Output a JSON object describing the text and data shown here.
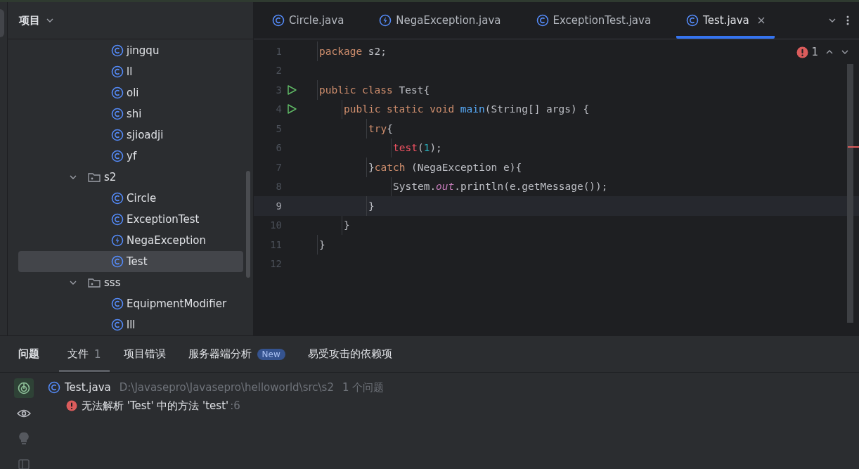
{
  "project_panel": {
    "title": "项目",
    "tree": [
      {
        "kind": "class",
        "label": "jingqu",
        "selected": false
      },
      {
        "kind": "class",
        "label": "ll",
        "selected": false
      },
      {
        "kind": "class",
        "label": "oli",
        "selected": false
      },
      {
        "kind": "class",
        "label": "shi",
        "selected": false
      },
      {
        "kind": "class",
        "label": "sjioadji",
        "selected": false
      },
      {
        "kind": "class",
        "label": "yf",
        "selected": false
      },
      {
        "kind": "folder",
        "label": "s2",
        "expanded": true,
        "selected": false,
        "children": [
          {
            "kind": "class",
            "label": "Circle",
            "selected": false
          },
          {
            "kind": "class",
            "label": "ExceptionTest",
            "selected": false
          },
          {
            "kind": "exception",
            "label": "NegaException",
            "selected": false
          },
          {
            "kind": "class",
            "label": "Test",
            "selected": true
          }
        ]
      },
      {
        "kind": "folder",
        "label": "sss",
        "expanded": true,
        "selected": false,
        "children": [
          {
            "kind": "class",
            "label": "EquipmentModifier",
            "selected": false
          },
          {
            "kind": "class",
            "label": "lll",
            "selected": false
          }
        ]
      }
    ]
  },
  "editor_tabs": [
    {
      "kind": "class",
      "label": "Circle.java",
      "selected": false,
      "closable": false
    },
    {
      "kind": "exception",
      "label": "NegaException.java",
      "selected": false,
      "closable": false
    },
    {
      "kind": "class",
      "label": "ExceptionTest.java",
      "selected": false,
      "closable": false
    },
    {
      "kind": "class",
      "label": "Test.java",
      "selected": true,
      "closable": true
    }
  ],
  "inspection": {
    "count": "1"
  },
  "code_lines": [
    {
      "number": "1",
      "current": false,
      "tokens": [
        {
          "kind": "kw",
          "text": "package"
        },
        {
          "kind": "plain",
          "text": " s2;"
        }
      ]
    },
    {
      "number": "2",
      "current": false
    },
    {
      "number": "3",
      "current": false,
      "runnable": true,
      "tokens": [
        {
          "kind": "kw",
          "text": "public class"
        },
        {
          "kind": "plain",
          "text": " Test{"
        }
      ],
      "children": [
        {
          "number": "4",
          "current": false,
          "runnable": true,
          "tokens": [
            {
              "kind": "kw",
              "text": "public static void"
            },
            {
              "kind": "fn",
              "text": " main"
            },
            {
              "kind": "plain",
              "text": "(String[] args) {"
            }
          ],
          "children": [
            {
              "number": "5",
              "current": false,
              "tokens": [
                {
                  "kind": "kw",
                  "text": "try"
                },
                {
                  "kind": "plain",
                  "text": "{"
                }
              ],
              "children": [
                {
                  "number": "6",
                  "current": false,
                  "tokens": [
                    {
                      "kind": "err",
                      "text": "test"
                    },
                    {
                      "kind": "plain",
                      "text": "("
                    },
                    {
                      "kind": "num",
                      "text": "1"
                    },
                    {
                      "kind": "plain",
                      "text": ");"
                    }
                  ]
                }
              ]
            },
            {
              "number": "7",
              "current": false,
              "tokens": [
                {
                  "kind": "plain",
                  "text": "}"
                },
                {
                  "kind": "kw",
                  "text": "catch"
                },
                {
                  "kind": "plain",
                  "text": " (NegaException e){"
                }
              ],
              "children": [
                {
                  "number": "8",
                  "current": false,
                  "tokens": [
                    {
                      "kind": "plain",
                      "text": "System."
                    },
                    {
                      "kind": "field",
                      "text": "out"
                    },
                    {
                      "kind": "plain",
                      "text": ".println(e.getMessage());"
                    }
                  ]
                }
              ]
            },
            {
              "number": "9",
              "current": true,
              "tokens": [
                {
                  "kind": "plain",
                  "text": "}"
                }
              ]
            }
          ]
        },
        {
          "number": "10",
          "current": false,
          "tokens": [
            {
              "kind": "plain",
              "text": "}"
            }
          ]
        }
      ]
    },
    {
      "number": "11",
      "current": false,
      "tokens": [
        {
          "kind": "plain",
          "text": "}"
        }
      ]
    },
    {
      "number": "12",
      "current": false
    }
  ],
  "problems_panel": {
    "title": "问题",
    "tabs": [
      {
        "label": "文件",
        "count": "1",
        "selected": true
      },
      {
        "label": "项目错误",
        "selected": false
      },
      {
        "label": "服务器端分析",
        "badge": "New",
        "selected": false
      },
      {
        "label": "易受攻击的依赖项",
        "selected": false
      }
    ],
    "file": {
      "name": "Test.java",
      "path": "D:\\Javasepro\\Javasepro\\helloworld\\src\\s2",
      "summary": "1 个问题"
    },
    "problems": [
      {
        "message": "无法解析 'Test' 中的方法 'test'",
        "line": ":6"
      }
    ]
  }
}
